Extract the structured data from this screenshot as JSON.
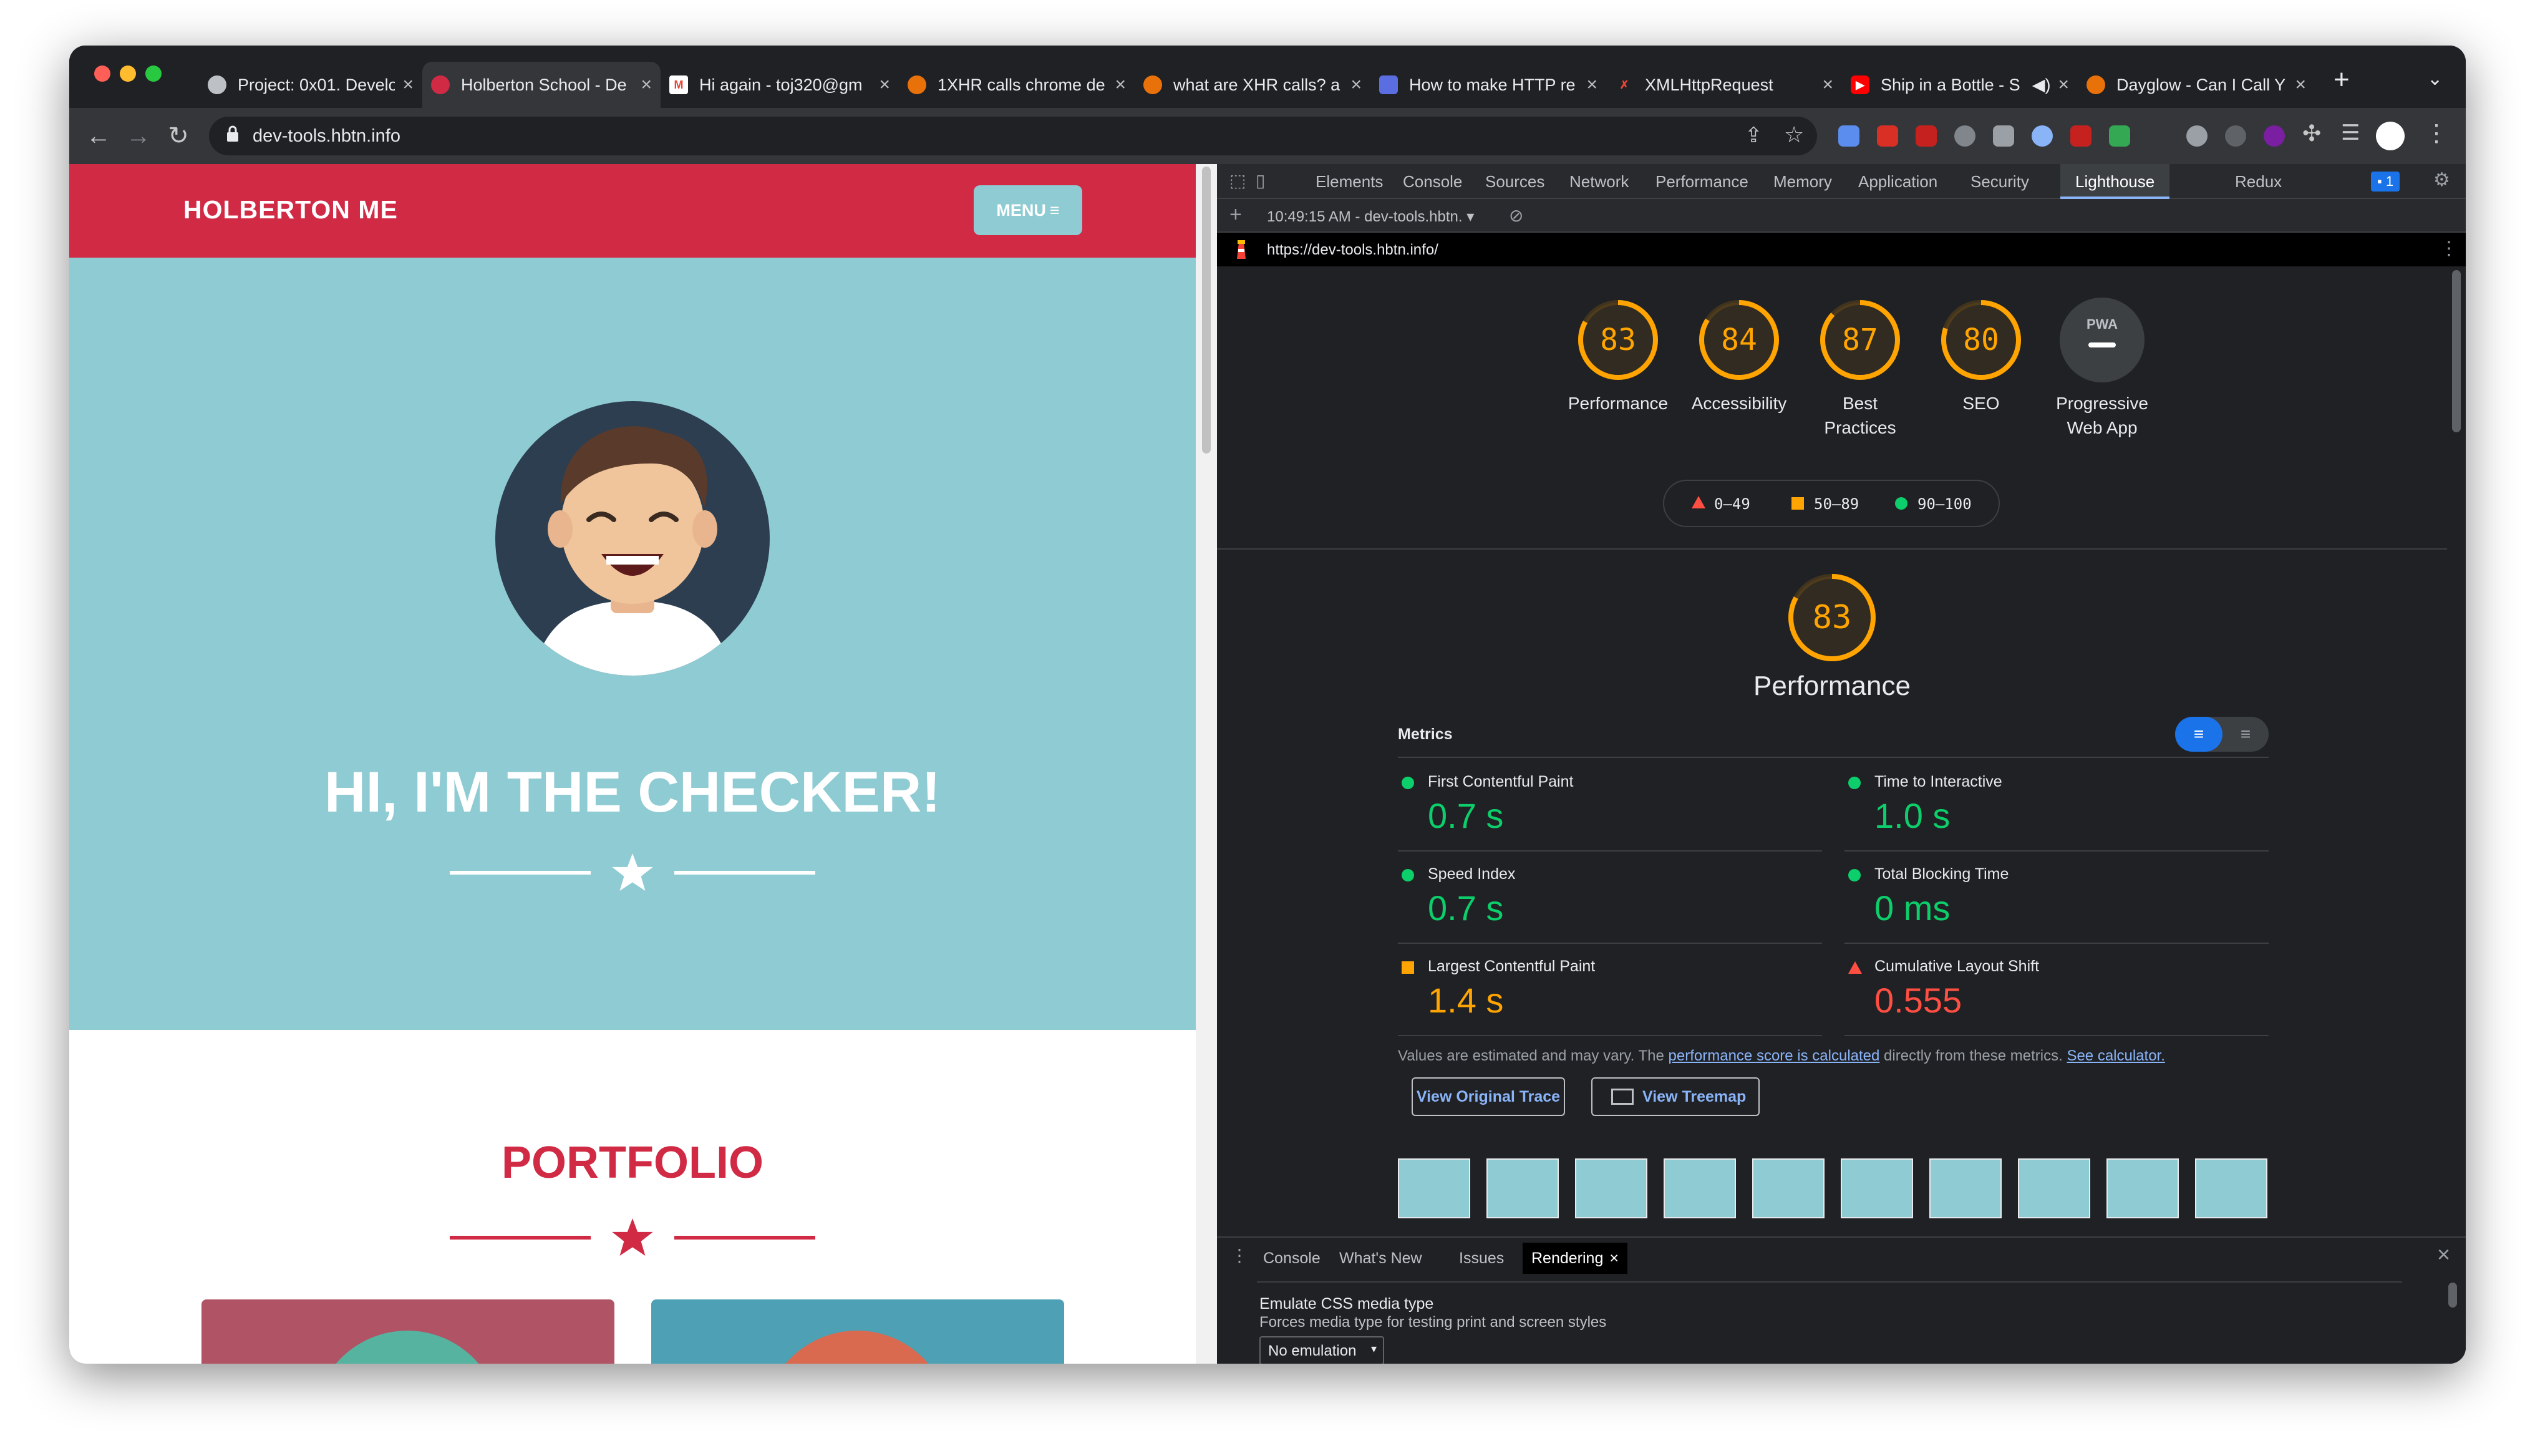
{
  "tabs": [
    {
      "title": "Project: 0x01. Develop",
      "favicon": "holberton-icon"
    },
    {
      "title": "Holberton School - De",
      "favicon": "holberton-icon"
    },
    {
      "title": "Hi again - toj320@gm",
      "favicon": "gmail-icon"
    },
    {
      "title": "1XHR calls chrome de",
      "favicon": "site-icon"
    },
    {
      "title": "what are XHR calls? a",
      "favicon": "site-icon"
    },
    {
      "title": "How to make HTTP re",
      "favicon": "site-icon"
    },
    {
      "title": "XMLHttpRequest",
      "favicon": "site-icon"
    },
    {
      "title": "Ship in a Bottle - S",
      "favicon": "youtube-icon"
    },
    {
      "title": "Dayglow - Can I Call Y",
      "favicon": "site-icon"
    }
  ],
  "address": {
    "url": "dev-tools.hbtn.info"
  },
  "page": {
    "brand": "HOLBERTON ME",
    "menu_label": "MENU",
    "hero_title": "HI, I'M THE CHECKER!",
    "portfolio_title": "PORTFOLIO"
  },
  "devtools": {
    "tabs": [
      "Elements",
      "Console",
      "Sources",
      "Network",
      "Performance",
      "Memory",
      "Application",
      "Security",
      "Lighthouse",
      "Redux"
    ],
    "active_tab": "Lighthouse",
    "issues_badge": "1",
    "report_selector": "10:49:15 AM - dev-tools.hbtn.",
    "report_url": "https://dev-tools.hbtn.info/",
    "scores": [
      {
        "label_1": "Performance",
        "label_2": "",
        "value": "83",
        "fraction": 0.83
      },
      {
        "label_1": "Accessibility",
        "label_2": "",
        "value": "84",
        "fraction": 0.84
      },
      {
        "label_1": "Best",
        "label_2": "Practices",
        "value": "87",
        "fraction": 0.87
      },
      {
        "label_1": "SEO",
        "label_2": "",
        "value": "80",
        "fraction": 0.8
      }
    ],
    "pwa": {
      "label_1": "Progressive",
      "label_2": "Web App",
      "badge": "PWA"
    },
    "legend": [
      "0–49",
      "50–89",
      "90–100"
    ],
    "perf_title": "Performance",
    "perf_score": "83",
    "metrics_heading": "Metrics",
    "metrics": [
      {
        "name": "First Contentful Paint",
        "value": "0.7 s",
        "status": "good"
      },
      {
        "name": "Time to Interactive",
        "value": "1.0 s",
        "status": "good"
      },
      {
        "name": "Speed Index",
        "value": "0.7 s",
        "status": "good"
      },
      {
        "name": "Total Blocking Time",
        "value": "0 ms",
        "status": "good"
      },
      {
        "name": "Largest Contentful Paint",
        "value": "1.4 s",
        "status": "average"
      },
      {
        "name": "Cumulative Layout Shift",
        "value": "0.555",
        "status": "poor"
      }
    ],
    "note_prefix": "Values are estimated and may vary. The ",
    "note_link1": "performance score is calculated",
    "note_mid": " directly from these metrics. ",
    "note_link2": "See calculator.",
    "btn_trace": "View Original Trace",
    "btn_treemap": "View Treemap",
    "colors": {
      "good": "#0cce6b",
      "average": "#ffa400",
      "poor": "#ff4e42"
    }
  },
  "drawer": {
    "tabs": [
      "Console",
      "What's New",
      "Issues",
      "Rendering"
    ],
    "active_tab": "Rendering",
    "setting_title": "Emulate CSS media type",
    "setting_desc": "Forces media type for testing print and screen styles",
    "select_value": "No emulation"
  }
}
